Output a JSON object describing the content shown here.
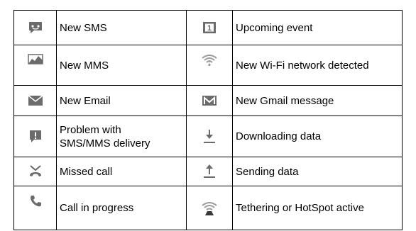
{
  "rows": [
    {
      "left": {
        "icon": "sms-icon",
        "label": "New SMS"
      },
      "right": {
        "icon": "calendar-event-icon",
        "label": "Upcoming event",
        "icon_text": "1"
      }
    },
    {
      "left": {
        "icon": "mms-icon",
        "label": "New MMS"
      },
      "right": {
        "icon": "wifi-icon",
        "label": "New Wi-Fi network detected"
      }
    },
    {
      "left": {
        "icon": "email-icon",
        "label": "New Email"
      },
      "right": {
        "icon": "gmail-icon",
        "label": "New Gmail message"
      }
    },
    {
      "left": {
        "icon": "sms-error-icon",
        "label": "Problem with SMS/MMS delivery",
        "label_lines": [
          "Problem with",
          "SMS/MMS delivery"
        ]
      },
      "right": {
        "icon": "download-icon",
        "label": "Downloading data"
      }
    },
    {
      "left": {
        "icon": "missed-call-icon",
        "label": "Missed call"
      },
      "right": {
        "icon": "upload-icon",
        "label": "Sending data"
      }
    },
    {
      "left": {
        "icon": "call-in-progress-icon",
        "label": "Call in progress"
      },
      "right": {
        "icon": "hotspot-icon",
        "label": "Tethering or HotSpot active"
      }
    }
  ],
  "icon_color": "#6b6b6b"
}
